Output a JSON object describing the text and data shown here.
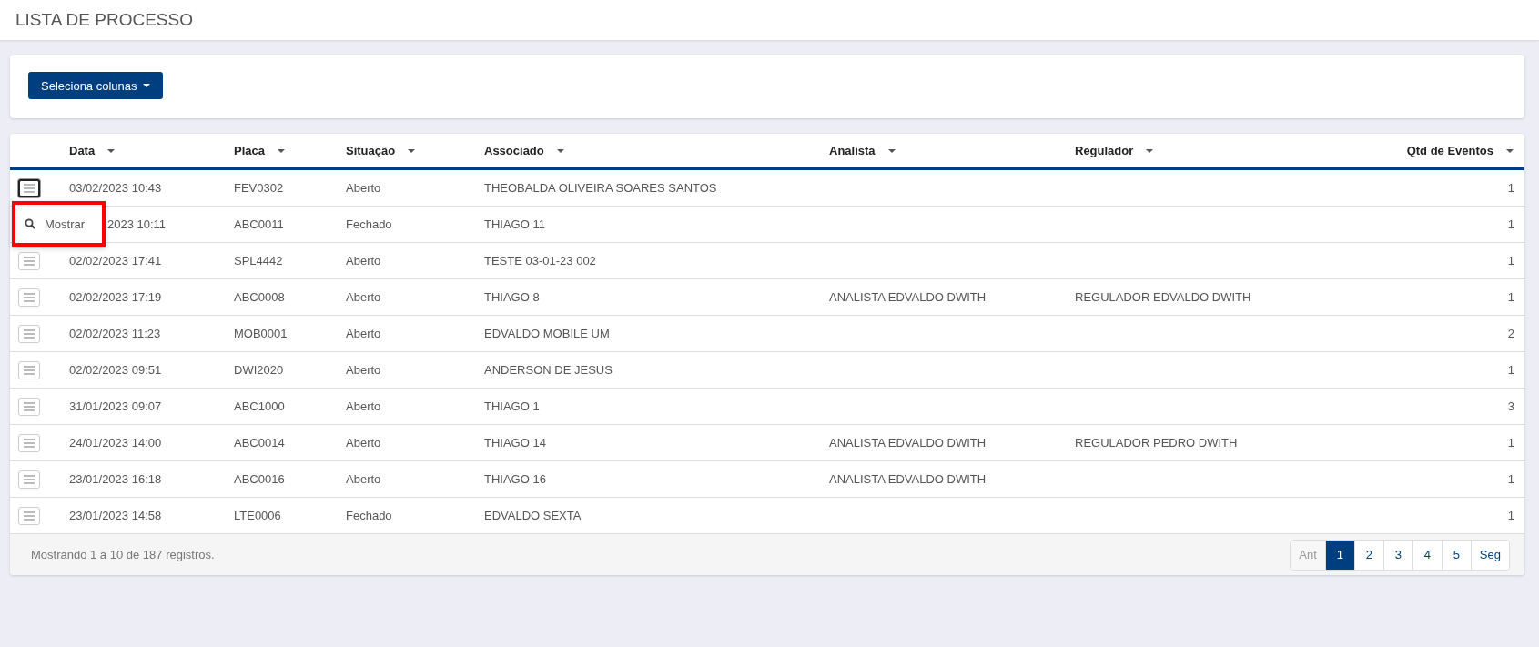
{
  "title": "LISTA DE PROCESSO",
  "toolbar": {
    "button": "Seleciona colunas"
  },
  "table": {
    "columns": [
      {
        "label": "Data"
      },
      {
        "label": "Placa"
      },
      {
        "label": "Situação"
      },
      {
        "label": "Associado"
      },
      {
        "label": "Analista"
      },
      {
        "label": "Regulador"
      },
      {
        "label": "Qtd de Eventos"
      }
    ],
    "rows": [
      {
        "menu_open": true,
        "cells": [
          "03/02/2023 10:43",
          "FEV0302",
          "Aberto",
          "THEOBALDA OLIVEIRA SOARES SANTOS",
          "",
          "",
          "1"
        ]
      },
      {
        "menu_open": false,
        "cells": [
          "2023 10:11",
          "ABC0011",
          "Fechado",
          "THIAGO 11",
          "",
          "",
          "1"
        ]
      },
      {
        "menu_open": false,
        "cells": [
          "02/02/2023 17:41",
          "SPL4442",
          "Aberto",
          "TESTE 03-01-23 002",
          "",
          "",
          "1"
        ]
      },
      {
        "menu_open": false,
        "cells": [
          "02/02/2023 17:19",
          "ABC0008",
          "Aberto",
          "THIAGO 8",
          "ANALISTA EDVALDO DWITH",
          "REGULADOR EDVALDO DWITH",
          "1"
        ]
      },
      {
        "menu_open": false,
        "cells": [
          "02/02/2023 11:23",
          "MOB0001",
          "Aberto",
          "EDVALDO MOBILE UM",
          "",
          "",
          "2"
        ]
      },
      {
        "menu_open": false,
        "cells": [
          "02/02/2023 09:51",
          "DWI2020",
          "Aberto",
          "ANDERSON DE JESUS",
          "",
          "",
          "1"
        ]
      },
      {
        "menu_open": false,
        "cells": [
          "31/01/2023 09:07",
          "ABC1000",
          "Aberto",
          "THIAGO 1",
          "",
          "",
          "3"
        ]
      },
      {
        "menu_open": false,
        "cells": [
          "24/01/2023 14:00",
          "ABC0014",
          "Aberto",
          "THIAGO 14",
          "ANALISTA EDVALDO DWITH",
          "REGULADOR PEDRO DWITH",
          "1"
        ]
      },
      {
        "menu_open": false,
        "cells": [
          "23/01/2023 16:18",
          "ABC0016",
          "Aberto",
          "THIAGO 16",
          "ANALISTA EDVALDO DWITH",
          "",
          "1"
        ]
      },
      {
        "menu_open": false,
        "cells": [
          "23/01/2023 14:58",
          "LTE0006",
          "Fechado",
          "EDVALDO SEXTA",
          "",
          "",
          "1"
        ]
      }
    ],
    "row_menu": {
      "items": [
        "Mostrar"
      ]
    },
    "footer": {
      "summary": "Mostrando 1 a 10 de 187 registros.",
      "pages": [
        {
          "label": "Ant",
          "disabled": true,
          "selected": false
        },
        {
          "label": "1",
          "disabled": false,
          "selected": true
        },
        {
          "label": "2",
          "disabled": false,
          "selected": false
        },
        {
          "label": "3",
          "disabled": false,
          "selected": false
        },
        {
          "label": "4",
          "disabled": false,
          "selected": false
        },
        {
          "label": "5",
          "disabled": false,
          "selected": false
        },
        {
          "label": "Seg",
          "disabled": false,
          "selected": false
        }
      ]
    }
  }
}
